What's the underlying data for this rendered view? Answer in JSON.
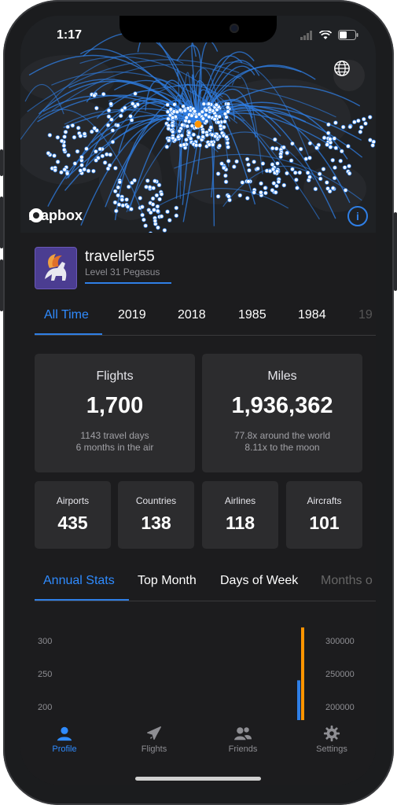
{
  "status": {
    "time": "1:17"
  },
  "map": {
    "logo_text": "mapbox"
  },
  "profile": {
    "username": "traveller55",
    "level": "Level 31 Pegasus"
  },
  "year_tabs": [
    "All Time",
    "2019",
    "2018",
    "1985",
    "1984",
    "19"
  ],
  "stats": {
    "flights": {
      "label": "Flights",
      "value": "1,700",
      "sub1": "1143 travel days",
      "sub2": "6 months in the air"
    },
    "miles": {
      "label": "Miles",
      "value": "1,936,362",
      "sub1": "77.8x around the world",
      "sub2": "8.11x to the moon"
    },
    "airports": {
      "label": "Airports",
      "value": "435"
    },
    "countries": {
      "label": "Countries",
      "value": "138"
    },
    "airlines": {
      "label": "Airlines",
      "value": "118"
    },
    "aircrafts": {
      "label": "Aircrafts",
      "value": "101"
    }
  },
  "stat_tabs": [
    "Annual Stats",
    "Top Month",
    "Days of Week",
    "Months o"
  ],
  "chart_data": {
    "type": "bar",
    "left_axis_ticks": [
      "300",
      "250",
      "200"
    ],
    "right_axis_ticks": [
      "300000",
      "250000",
      "200000"
    ],
    "series": [
      {
        "values": [
          240
        ],
        "color": "#2f7fe6"
      },
      {
        "values": [
          320000
        ],
        "color": "#ff9500"
      }
    ]
  },
  "tabbar": [
    "Profile",
    "Flights",
    "Friends",
    "Settings"
  ],
  "colors": {
    "accent": "#2f7fe6",
    "orange": "#ff9500",
    "background": "#1c1c1e",
    "card": "#2c2c2e"
  }
}
